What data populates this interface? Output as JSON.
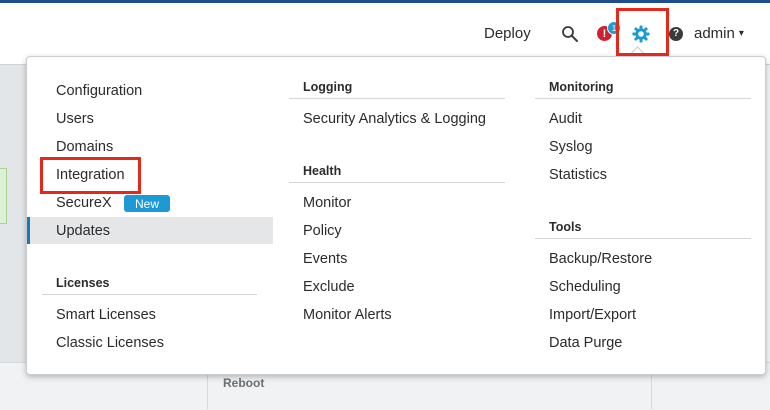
{
  "header": {
    "deploy_label": "Deploy",
    "alert_count": "1",
    "alert_symbol": "!",
    "help_symbol": "?",
    "user_label": "admin",
    "user_caret": "▾",
    "icons": [
      "search-icon",
      "alert-icon",
      "gear-icon",
      "help-icon",
      "caret-down-icon"
    ],
    "accent_color": "#1b9ad6",
    "alert_color": "#cf2030",
    "highlight_box_color": "#e4281b"
  },
  "menu": {
    "col1": {
      "items": [
        "Configuration",
        "Users",
        "Domains",
        "Integration",
        "SecureX",
        "Updates"
      ],
      "securex_badge": "New",
      "selected": "Updates",
      "licenses_title": "Licenses",
      "licenses_items": [
        "Smart Licenses",
        "Classic Licenses"
      ]
    },
    "col2": {
      "logging_title": "Logging",
      "logging_items": [
        "Security Analytics & Logging"
      ],
      "health_title": "Health",
      "health_items": [
        "Monitor",
        "Policy",
        "Events",
        "Exclude",
        "Monitor Alerts"
      ]
    },
    "col3": {
      "monitoring_title": "Monitoring",
      "monitoring_items": [
        "Audit",
        "Syslog",
        "Statistics"
      ],
      "tools_title": "Tools",
      "tools_items": [
        "Backup/Restore",
        "Scheduling",
        "Import/Export",
        "Data Purge"
      ]
    }
  },
  "background": {
    "reboot_label": "Reboot"
  }
}
